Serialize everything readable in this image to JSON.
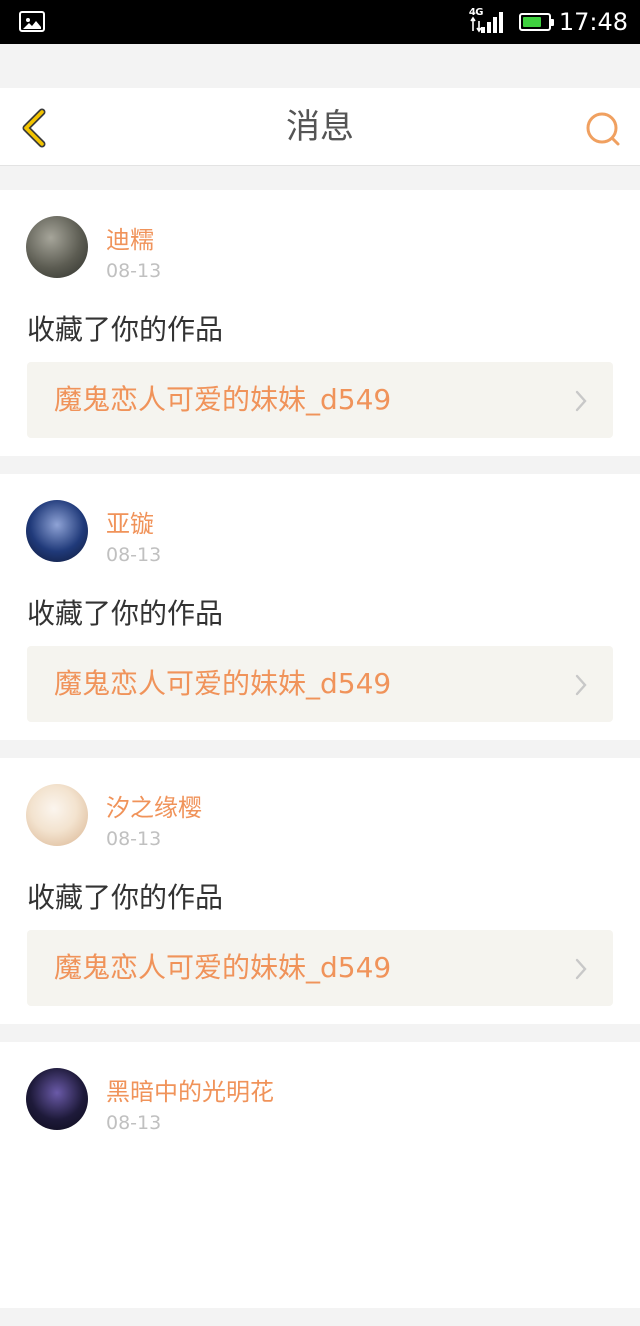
{
  "status_bar": {
    "network": "4G",
    "time": "17:48",
    "battery_level": 0.75,
    "icons": [
      "gallery-icon",
      "signal-icon",
      "battery-icon"
    ]
  },
  "header": {
    "title": "消息",
    "back_icon": "chevron-left-icon",
    "search_icon": "search-icon",
    "accent": "#f3c400",
    "search_color": "#f0a060"
  },
  "colors": {
    "username": "#f0935a",
    "link_bg": "#f5f4ef"
  },
  "messages": [
    {
      "username": "迪糯",
      "date": "08-13",
      "action": "收藏了你的作品",
      "work": "魔鬼恋人可爱的妹妹_d549",
      "avatar_palette": [
        "#5c5c52",
        "#a6a59a",
        "#2d2f2a"
      ]
    },
    {
      "username": "亚镟",
      "date": "08-13",
      "action": "收藏了你的作品",
      "work": "魔鬼恋人可爱的妹妹_d549",
      "avatar_palette": [
        "#203a7a",
        "#8fa3d6",
        "#0e1733"
      ]
    },
    {
      "username": "汐之缘樱",
      "date": "08-13",
      "action": "收藏了你的作品",
      "work": "魔鬼恋人可爱的妹妹_d549",
      "avatar_palette": [
        "#f3e3cf",
        "#d8b28e",
        "#fbf5ee"
      ]
    },
    {
      "username": "黑暗中的光明花",
      "date": "08-13",
      "action": "",
      "work": "",
      "avatar_palette": [
        "#1e1a3a",
        "#6a5aa8",
        "#0b0a18"
      ]
    }
  ]
}
